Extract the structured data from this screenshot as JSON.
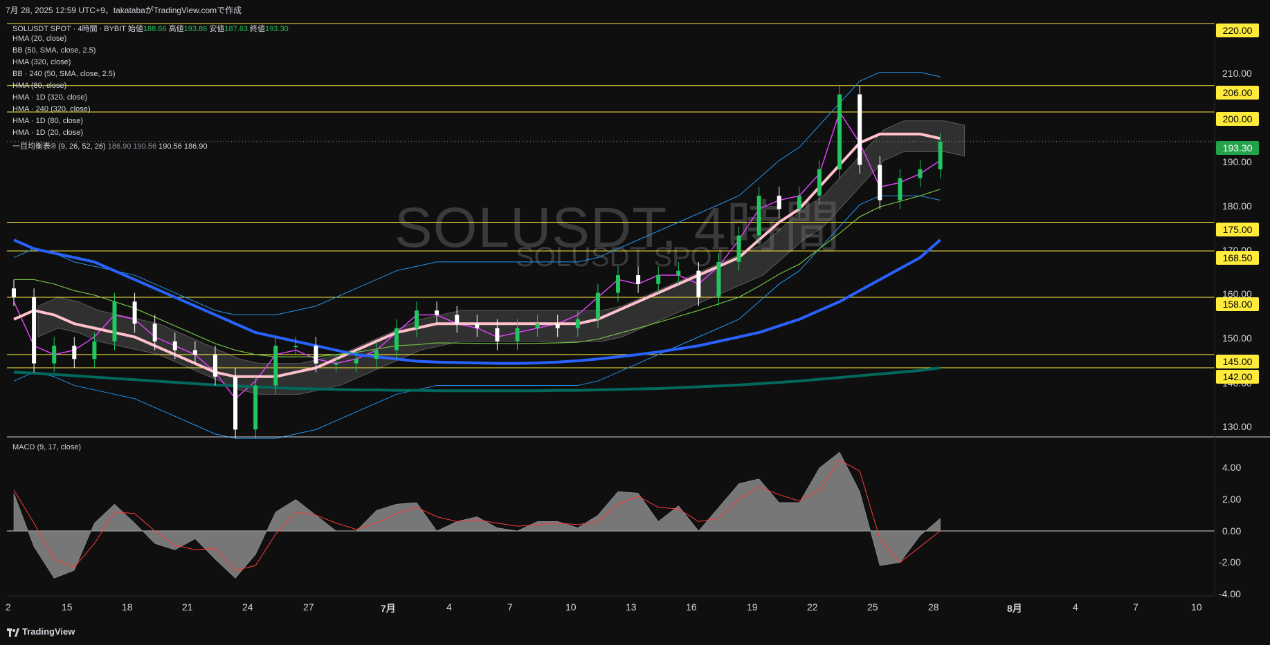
{
  "header": {
    "caption": "7月 28, 2025 12:59 UTC+9、takatabaがTradingView.comで作成"
  },
  "watermark": {
    "big": "SOLUSDT, 4時間",
    "small": "SOLUSDT SPOT"
  },
  "legend": {
    "symbol_line": {
      "name": "SOLUSDT SPOT · 4時間 · BYBIT",
      "open_label": "始値",
      "open": "188.66",
      "high_label": "高値",
      "high": "193.86",
      "low_label": "安値",
      "low": "187.63",
      "close_label": "終値",
      "close": "193.30"
    },
    "indicators": [
      "HMA (20, close)",
      "BB (50, SMA, close, 2.5)",
      "HMA (320, close)",
      "BB · 240 (50, SMA, close, 2.5)",
      "HMA (80, close)",
      "HMA · 1D (320, close)",
      "HMA · 240 (320, close)",
      "HMA · 1D (80, close)",
      "HMA · 1D (20, close)"
    ],
    "ichimoku": {
      "name": "一目均衡表® (9, 26, 52, 26)",
      "v1": "186.90",
      "v2": "190.56",
      "v3": "190.56",
      "v4": "186.90"
    },
    "macd": "MACD (9, 17, close)"
  },
  "price_tags": {
    "levels": [
      "220.00",
      "206.00",
      "200.00",
      "175.00",
      "168.50",
      "158.00",
      "145.00",
      "142.00"
    ],
    "current": "193.30"
  },
  "price_axis": [
    "210.00",
    "190.00",
    "180.00",
    "170.00",
    "160.00",
    "150.00",
    "140.00",
    "130.00"
  ],
  "macd_axis": [
    "4.00",
    "2.00",
    "0.00",
    "-2.00",
    "-4.00"
  ],
  "time_axis": [
    "2",
    "15",
    "18",
    "21",
    "24",
    "27",
    "7月",
    "4",
    "7",
    "10",
    "13",
    "16",
    "19",
    "22",
    "25",
    "28",
    "8月",
    "4",
    "7",
    "10"
  ],
  "footer": {
    "brand": "TradingView"
  },
  "colors": {
    "background": "#0f0f0f",
    "level_line": "#ffeb3b",
    "candle_up": "#22c55e",
    "candle_down": "#ffffff",
    "hma20": "#e040fb",
    "hma80": "#ffc0cb",
    "hma320": "#2962ff",
    "hma_long": "#00695c",
    "bb": "#2196f3",
    "green_line": "#76c043",
    "cloud": "#707070",
    "macd_hist": "#8a8a8a",
    "macd_signal": "#ff3b3b"
  },
  "chart_data": [
    {
      "type": "candlestick",
      "title": "SOLUSDT, 4時間",
      "ylim": [
        127,
        224
      ],
      "horizontal_levels": [
        220,
        206,
        200,
        175,
        168.5,
        158,
        145,
        142
      ],
      "current_price": 193.3,
      "x": [
        "6/12",
        "6/13",
        "6/14",
        "6/15",
        "6/16",
        "6/17",
        "6/18",
        "6/19",
        "6/20",
        "6/21",
        "6/22",
        "6/23",
        "6/24",
        "6/25",
        "6/26",
        "6/27",
        "6/28",
        "6/29",
        "6/30",
        "7/1",
        "7/2",
        "7/3",
        "7/4",
        "7/5",
        "7/6",
        "7/7",
        "7/8",
        "7/9",
        "7/10",
        "7/11",
        "7/12",
        "7/13",
        "7/14",
        "7/15",
        "7/16",
        "7/17",
        "7/18",
        "7/19",
        "7/20",
        "7/21",
        "7/22",
        "7/23",
        "7/24",
        "7/25",
        "7/26",
        "7/27",
        "7/28"
      ],
      "close": [
        158,
        143,
        147,
        144,
        148,
        157,
        152,
        148,
        146,
        145,
        140,
        128,
        138,
        147,
        147,
        143,
        143,
        144,
        146,
        151,
        155,
        154,
        152,
        151,
        148,
        151,
        152,
        151,
        153,
        159,
        163,
        161,
        163,
        164,
        158,
        166,
        172,
        181,
        178,
        181,
        187,
        204,
        188,
        180,
        185,
        187,
        193.3
      ],
      "series": [
        {
          "name": "HMA (20, close)",
          "values": [
            157,
            147,
            145,
            146,
            149,
            154,
            153,
            149,
            147,
            145,
            141,
            135,
            139,
            145,
            146,
            144,
            143,
            144,
            146,
            150,
            154,
            154,
            152,
            151,
            149,
            150,
            151,
            152,
            154,
            158,
            162,
            161,
            163,
            163,
            161,
            165,
            171,
            178,
            180,
            181,
            186,
            200,
            193,
            183,
            184,
            186,
            189
          ]
        },
        {
          "name": "HMA (80, close)",
          "values": [
            153,
            155,
            154,
            152,
            151,
            150,
            149,
            147,
            145,
            143,
            141,
            140,
            140,
            140,
            141,
            142,
            144,
            146,
            148,
            150,
            151,
            152,
            152,
            152,
            152,
            152,
            152,
            152,
            152,
            153,
            155,
            157,
            159,
            161,
            163,
            165,
            167,
            171,
            175,
            178,
            183,
            188,
            193,
            195,
            195,
            195,
            194
          ]
        },
        {
          "name": "HMA (320, close)",
          "values": [
            171,
            169,
            168,
            167,
            166,
            164,
            162,
            160,
            158,
            156,
            154,
            152,
            150,
            149,
            148,
            147,
            146,
            145,
            144.5,
            144,
            143.5,
            143.3,
            143.2,
            143.1,
            143,
            143,
            143.1,
            143.3,
            143.6,
            144,
            144.5,
            145,
            145.6,
            146.3,
            147,
            148,
            149,
            150,
            151.5,
            153,
            155,
            157,
            159.5,
            162,
            164.5,
            167,
            171
          ]
        },
        {
          "name": "HMA · 1D (320, close)",
          "values": [
            141,
            140.8,
            140.5,
            140.2,
            139.9,
            139.6,
            139.3,
            139,
            138.7,
            138.4,
            138.1,
            137.9,
            137.7,
            137.5,
            137.3,
            137.2,
            137.1,
            137,
            137,
            136.9,
            136.9,
            136.8,
            136.8,
            136.8,
            136.8,
            136.8,
            136.8,
            136.9,
            136.9,
            137,
            137.1,
            137.2,
            137.3,
            137.5,
            137.7,
            137.9,
            138.1,
            138.4,
            138.7,
            139,
            139.4,
            139.8,
            140.2,
            140.6,
            141,
            141.4,
            142
          ]
        }
      ]
    },
    {
      "type": "area",
      "title": "MACD (9, 17, close)",
      "ylim": [
        -4,
        5
      ],
      "x": [
        "6/12",
        "6/13",
        "6/14",
        "6/15",
        "6/16",
        "6/17",
        "6/18",
        "6/19",
        "6/20",
        "6/21",
        "6/22",
        "6/23",
        "6/24",
        "6/25",
        "6/26",
        "6/27",
        "6/28",
        "6/29",
        "6/30",
        "7/1",
        "7/2",
        "7/3",
        "7/4",
        "7/5",
        "7/6",
        "7/7",
        "7/8",
        "7/9",
        "7/10",
        "7/11",
        "7/12",
        "7/13",
        "7/14",
        "7/15",
        "7/16",
        "7/17",
        "7/18",
        "7/19",
        "7/20",
        "7/21",
        "7/22",
        "7/23",
        "7/24",
        "7/25",
        "7/26",
        "7/27",
        "7/28"
      ],
      "series": [
        {
          "name": "MACD",
          "values": [
            2.4,
            -1.0,
            -3.0,
            -2.5,
            0.5,
            1.7,
            0.5,
            -0.8,
            -1.2,
            -0.5,
            -1.8,
            -3.0,
            -1.5,
            1.2,
            2.0,
            1.0,
            0.0,
            0.0,
            1.3,
            1.7,
            1.8,
            0.0,
            0.6,
            0.9,
            0.2,
            0.0,
            0.6,
            0.6,
            0.2,
            1.0,
            2.5,
            2.4,
            0.6,
            1.6,
            0.0,
            1.5,
            3.0,
            3.3,
            1.8,
            1.8,
            4.0,
            5.0,
            2.5,
            -2.2,
            -2.0,
            -0.3,
            0.8
          ]
        },
        {
          "name": "Signal",
          "values": [
            2.6,
            0.5,
            -1.8,
            -2.3,
            -0.8,
            1.2,
            1.1,
            0.0,
            -0.9,
            -1.2,
            -1.1,
            -2.5,
            -2.2,
            -0.2,
            1.2,
            1.0,
            0.5,
            0.1,
            0.5,
            1.1,
            1.5,
            0.9,
            0.6,
            0.7,
            0.5,
            0.3,
            0.4,
            0.5,
            0.4,
            0.6,
            1.7,
            2.2,
            1.5,
            1.4,
            0.6,
            0.8,
            2.0,
            2.8,
            2.3,
            1.9,
            2.6,
            4.5,
            3.8,
            -0.5,
            -2.0,
            -1.0,
            0.0
          ]
        }
      ]
    }
  ]
}
